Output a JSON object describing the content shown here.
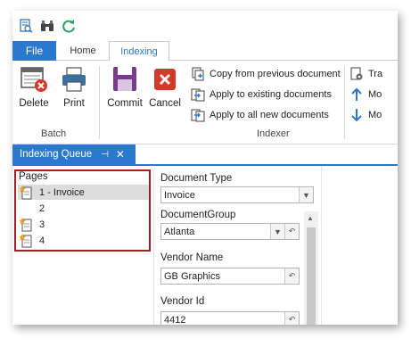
{
  "quick_access": [
    {
      "name": "search-doc-icon"
    },
    {
      "name": "binoculars-icon"
    },
    {
      "name": "refresh-icon"
    }
  ],
  "tabs": {
    "file": "File",
    "home": "Home",
    "indexing": "Indexing"
  },
  "ribbon": {
    "delete": "Delete",
    "print": "Print",
    "batch_group": "Batch",
    "commit": "Commit",
    "cancel": "Cancel",
    "copy_prev": "Copy from previous document",
    "apply_existing": "Apply to existing documents",
    "apply_new": "Apply to all new documents",
    "indexer_group": "Indexer",
    "right_1": "Tra",
    "right_2": "Mo",
    "right_3": "Mo"
  },
  "doc_tab": {
    "title": "Indexing Queue",
    "pin": "⊣",
    "close": "✕"
  },
  "pages": {
    "title": "Pages",
    "items": [
      "1 - Invoice",
      "2",
      "3",
      "4"
    ]
  },
  "fields": {
    "document_type_label": "Document Type",
    "document_type_value": "Invoice",
    "document_group_label": "DocumentGroup",
    "document_group_value": "Atlanta",
    "vendor_name_label": "Vendor Name",
    "vendor_name_value": "GB Graphics",
    "vendor_id_label": "Vendor Id",
    "vendor_id_value": "4412"
  },
  "colors": {
    "accent": "#2b78cf",
    "highlight_border": "#a31d24",
    "cancel_red": "#d23a2c",
    "commit_purple": "#7a3b8f"
  }
}
